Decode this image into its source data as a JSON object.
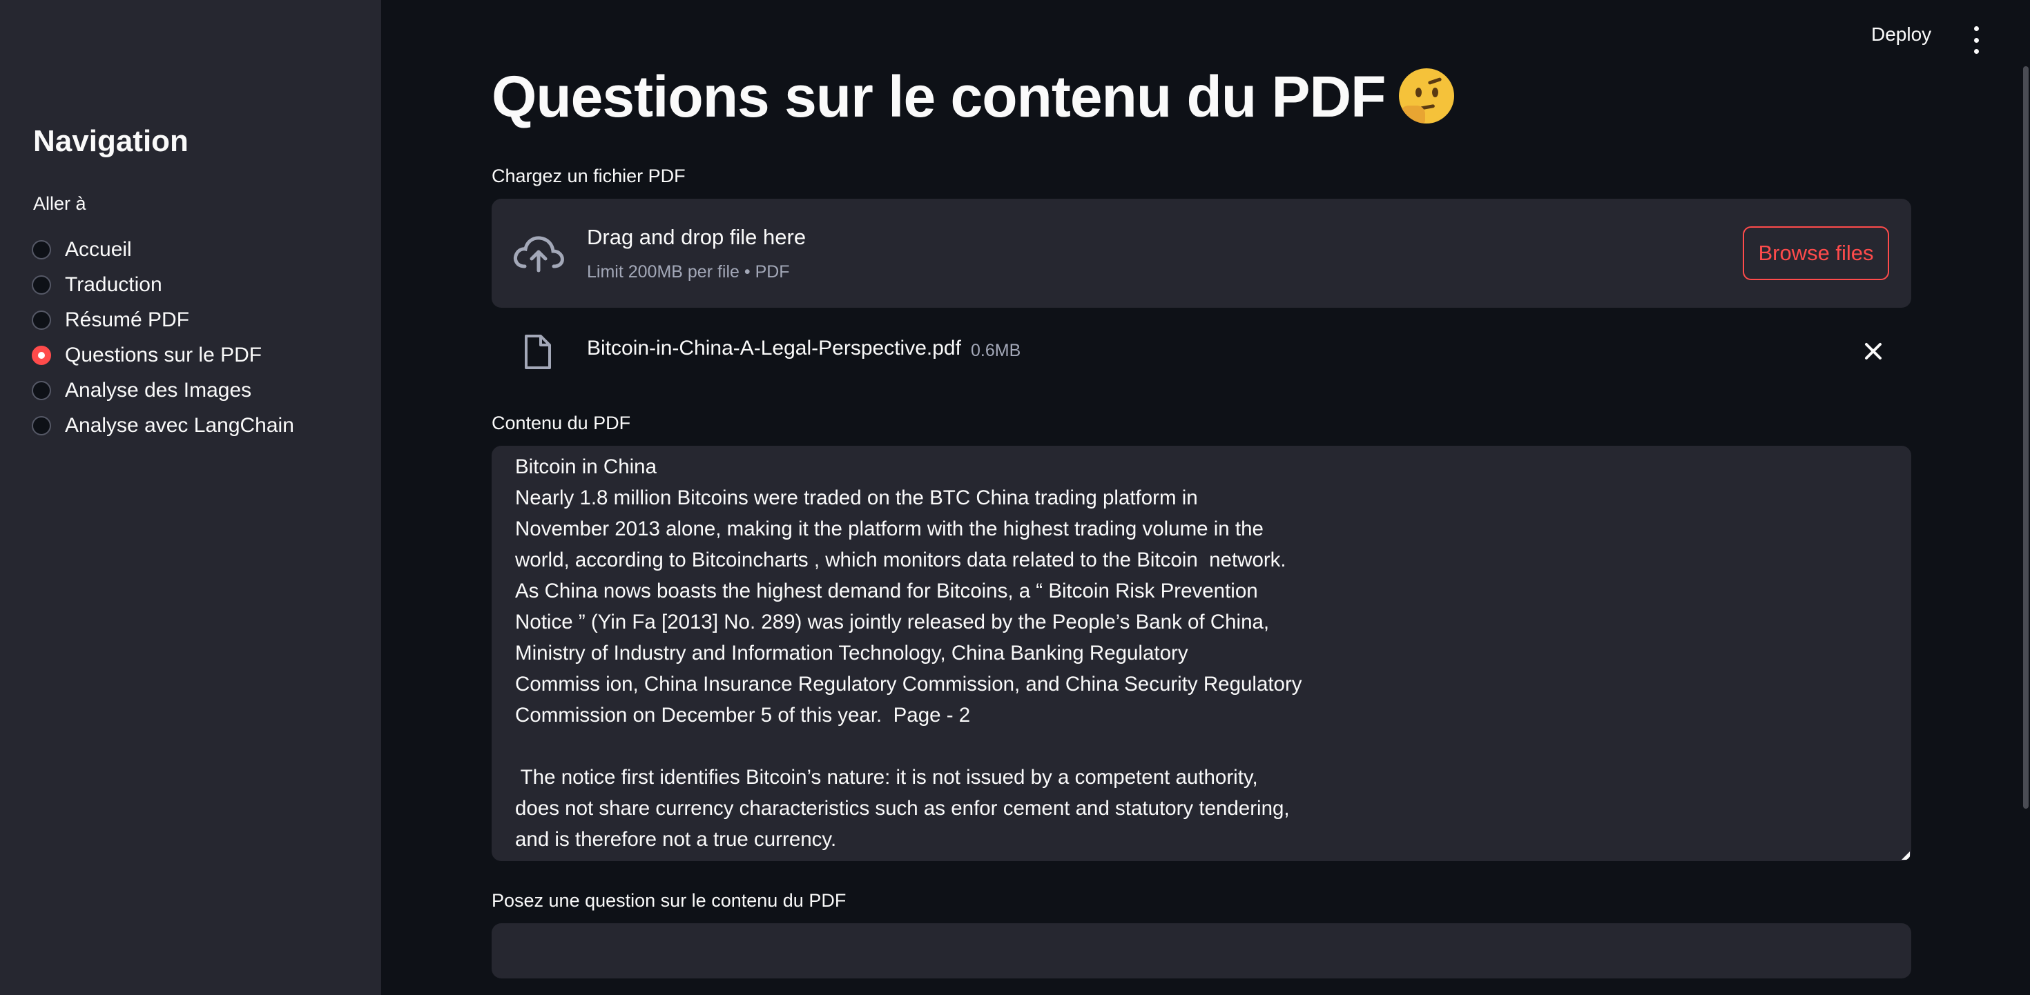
{
  "sidebar": {
    "title": "Navigation",
    "subheading": "Aller à",
    "items": [
      {
        "label": "Accueil",
        "selected": false
      },
      {
        "label": "Traduction",
        "selected": false
      },
      {
        "label": "Résumé PDF",
        "selected": false
      },
      {
        "label": "Questions sur le PDF",
        "selected": true
      },
      {
        "label": "Analyse des Images",
        "selected": false
      },
      {
        "label": "Analyse avec LangChain",
        "selected": false
      }
    ]
  },
  "toolbar": {
    "deploy_label": "Deploy",
    "menu_icon": "more-vertical-icon"
  },
  "main": {
    "title": "Questions sur le contenu du PDF",
    "title_emoji": "thinking-face",
    "uploader": {
      "label": "Chargez un fichier PDF",
      "drag_text": "Drag and drop file here",
      "limit_text": "Limit 200MB per file • PDF",
      "browse_label": "Browse files",
      "icon": "cloud-upload-icon"
    },
    "uploaded_file": {
      "name": "Bitcoin-in-China-A-Legal-Perspective.pdf",
      "size": "0.6MB"
    },
    "content": {
      "label": "Contenu du PDF",
      "text": "Bitcoin in China\nNearly 1.8 million Bitcoins were traded on the BTC China trading platform in\nNovember 2013 alone, making it the platform with the highest trading volume in the\nworld, according to Bitcoincharts , which monitors data related to the Bitcoin  network.\nAs China nows boasts the highest demand for Bitcoins, a “ Bitcoin Risk Prevention\nNotice ” (Yin Fa [2013] No. 289) was jointly released by the People’s Bank of China,\nMinistry of Industry and Information Technology, China Banking Regulatory\nCommiss ion, China Insurance Regulatory Commission, and China Security Regulatory\nCommission on December 5 of this year.  Page - 2\n\n The notice first identifies Bitcoin’s nature: it is not issued by a competent authority,\ndoes not share currency characteristics such as enfor cement and statutory tendering,\nand is therefore not a true currency."
    },
    "question": {
      "label": "Posez une question sur le contenu du PDF",
      "value": ""
    }
  },
  "colors": {
    "background": "#0e1117",
    "sidebar": "#262730",
    "accent": "#ff4b4b",
    "muted_text": "#a3a8b8"
  }
}
